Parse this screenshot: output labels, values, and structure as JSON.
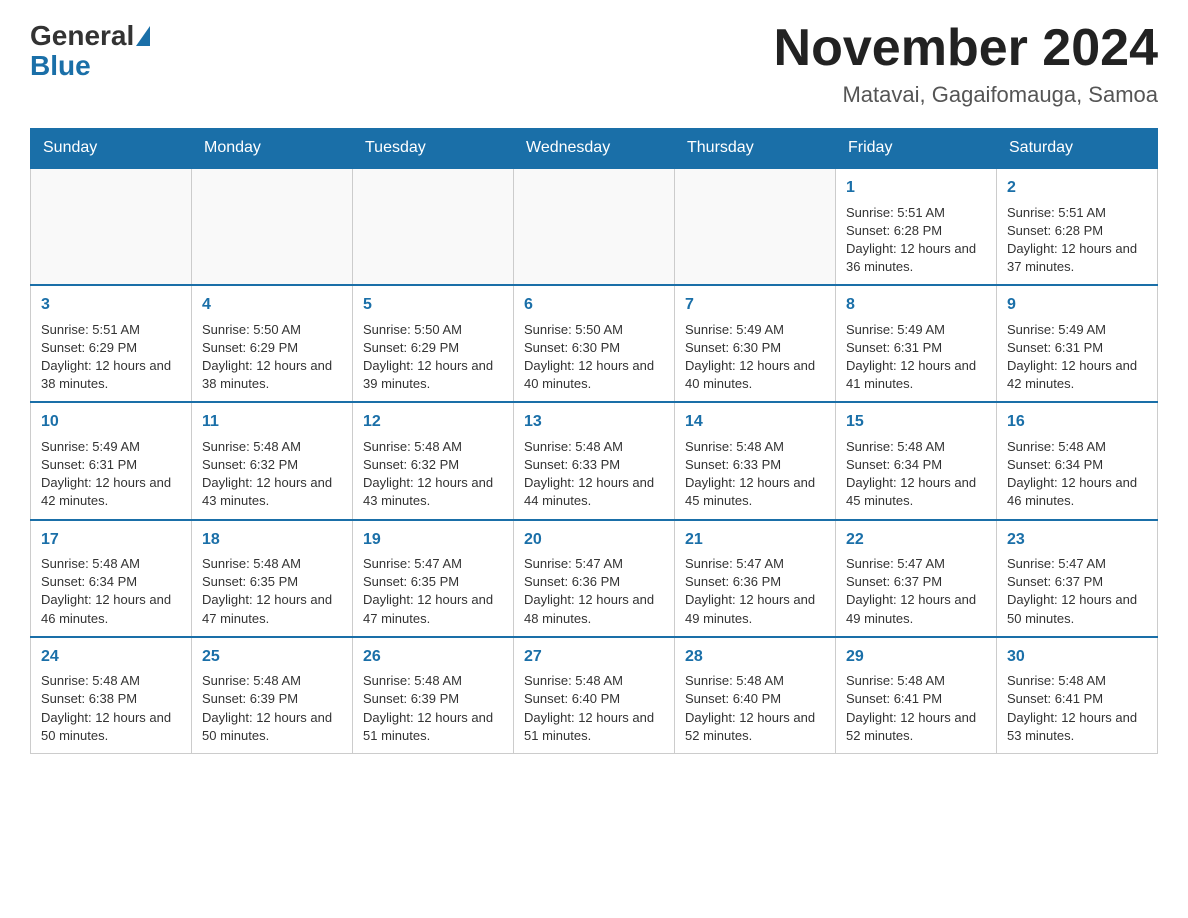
{
  "header": {
    "logo": {
      "general": "General",
      "blue": "Blue"
    },
    "title": "November 2024",
    "subtitle": "Matavai, Gagaifomauga, Samoa"
  },
  "calendar": {
    "days_of_week": [
      "Sunday",
      "Monday",
      "Tuesday",
      "Wednesday",
      "Thursday",
      "Friday",
      "Saturday"
    ],
    "weeks": [
      [
        {
          "day": "",
          "sunrise": "",
          "sunset": "",
          "daylight": ""
        },
        {
          "day": "",
          "sunrise": "",
          "sunset": "",
          "daylight": ""
        },
        {
          "day": "",
          "sunrise": "",
          "sunset": "",
          "daylight": ""
        },
        {
          "day": "",
          "sunrise": "",
          "sunset": "",
          "daylight": ""
        },
        {
          "day": "",
          "sunrise": "",
          "sunset": "",
          "daylight": ""
        },
        {
          "day": "1",
          "sunrise": "Sunrise: 5:51 AM",
          "sunset": "Sunset: 6:28 PM",
          "daylight": "Daylight: 12 hours and 36 minutes."
        },
        {
          "day": "2",
          "sunrise": "Sunrise: 5:51 AM",
          "sunset": "Sunset: 6:28 PM",
          "daylight": "Daylight: 12 hours and 37 minutes."
        }
      ],
      [
        {
          "day": "3",
          "sunrise": "Sunrise: 5:51 AM",
          "sunset": "Sunset: 6:29 PM",
          "daylight": "Daylight: 12 hours and 38 minutes."
        },
        {
          "day": "4",
          "sunrise": "Sunrise: 5:50 AM",
          "sunset": "Sunset: 6:29 PM",
          "daylight": "Daylight: 12 hours and 38 minutes."
        },
        {
          "day": "5",
          "sunrise": "Sunrise: 5:50 AM",
          "sunset": "Sunset: 6:29 PM",
          "daylight": "Daylight: 12 hours and 39 minutes."
        },
        {
          "day": "6",
          "sunrise": "Sunrise: 5:50 AM",
          "sunset": "Sunset: 6:30 PM",
          "daylight": "Daylight: 12 hours and 40 minutes."
        },
        {
          "day": "7",
          "sunrise": "Sunrise: 5:49 AM",
          "sunset": "Sunset: 6:30 PM",
          "daylight": "Daylight: 12 hours and 40 minutes."
        },
        {
          "day": "8",
          "sunrise": "Sunrise: 5:49 AM",
          "sunset": "Sunset: 6:31 PM",
          "daylight": "Daylight: 12 hours and 41 minutes."
        },
        {
          "day": "9",
          "sunrise": "Sunrise: 5:49 AM",
          "sunset": "Sunset: 6:31 PM",
          "daylight": "Daylight: 12 hours and 42 minutes."
        }
      ],
      [
        {
          "day": "10",
          "sunrise": "Sunrise: 5:49 AM",
          "sunset": "Sunset: 6:31 PM",
          "daylight": "Daylight: 12 hours and 42 minutes."
        },
        {
          "day": "11",
          "sunrise": "Sunrise: 5:48 AM",
          "sunset": "Sunset: 6:32 PM",
          "daylight": "Daylight: 12 hours and 43 minutes."
        },
        {
          "day": "12",
          "sunrise": "Sunrise: 5:48 AM",
          "sunset": "Sunset: 6:32 PM",
          "daylight": "Daylight: 12 hours and 43 minutes."
        },
        {
          "day": "13",
          "sunrise": "Sunrise: 5:48 AM",
          "sunset": "Sunset: 6:33 PM",
          "daylight": "Daylight: 12 hours and 44 minutes."
        },
        {
          "day": "14",
          "sunrise": "Sunrise: 5:48 AM",
          "sunset": "Sunset: 6:33 PM",
          "daylight": "Daylight: 12 hours and 45 minutes."
        },
        {
          "day": "15",
          "sunrise": "Sunrise: 5:48 AM",
          "sunset": "Sunset: 6:34 PM",
          "daylight": "Daylight: 12 hours and 45 minutes."
        },
        {
          "day": "16",
          "sunrise": "Sunrise: 5:48 AM",
          "sunset": "Sunset: 6:34 PM",
          "daylight": "Daylight: 12 hours and 46 minutes."
        }
      ],
      [
        {
          "day": "17",
          "sunrise": "Sunrise: 5:48 AM",
          "sunset": "Sunset: 6:34 PM",
          "daylight": "Daylight: 12 hours and 46 minutes."
        },
        {
          "day": "18",
          "sunrise": "Sunrise: 5:48 AM",
          "sunset": "Sunset: 6:35 PM",
          "daylight": "Daylight: 12 hours and 47 minutes."
        },
        {
          "day": "19",
          "sunrise": "Sunrise: 5:47 AM",
          "sunset": "Sunset: 6:35 PM",
          "daylight": "Daylight: 12 hours and 47 minutes."
        },
        {
          "day": "20",
          "sunrise": "Sunrise: 5:47 AM",
          "sunset": "Sunset: 6:36 PM",
          "daylight": "Daylight: 12 hours and 48 minutes."
        },
        {
          "day": "21",
          "sunrise": "Sunrise: 5:47 AM",
          "sunset": "Sunset: 6:36 PM",
          "daylight": "Daylight: 12 hours and 49 minutes."
        },
        {
          "day": "22",
          "sunrise": "Sunrise: 5:47 AM",
          "sunset": "Sunset: 6:37 PM",
          "daylight": "Daylight: 12 hours and 49 minutes."
        },
        {
          "day": "23",
          "sunrise": "Sunrise: 5:47 AM",
          "sunset": "Sunset: 6:37 PM",
          "daylight": "Daylight: 12 hours and 50 minutes."
        }
      ],
      [
        {
          "day": "24",
          "sunrise": "Sunrise: 5:48 AM",
          "sunset": "Sunset: 6:38 PM",
          "daylight": "Daylight: 12 hours and 50 minutes."
        },
        {
          "day": "25",
          "sunrise": "Sunrise: 5:48 AM",
          "sunset": "Sunset: 6:39 PM",
          "daylight": "Daylight: 12 hours and 50 minutes."
        },
        {
          "day": "26",
          "sunrise": "Sunrise: 5:48 AM",
          "sunset": "Sunset: 6:39 PM",
          "daylight": "Daylight: 12 hours and 51 minutes."
        },
        {
          "day": "27",
          "sunrise": "Sunrise: 5:48 AM",
          "sunset": "Sunset: 6:40 PM",
          "daylight": "Daylight: 12 hours and 51 minutes."
        },
        {
          "day": "28",
          "sunrise": "Sunrise: 5:48 AM",
          "sunset": "Sunset: 6:40 PM",
          "daylight": "Daylight: 12 hours and 52 minutes."
        },
        {
          "day": "29",
          "sunrise": "Sunrise: 5:48 AM",
          "sunset": "Sunset: 6:41 PM",
          "daylight": "Daylight: 12 hours and 52 minutes."
        },
        {
          "day": "30",
          "sunrise": "Sunrise: 5:48 AM",
          "sunset": "Sunset: 6:41 PM",
          "daylight": "Daylight: 12 hours and 53 minutes."
        }
      ]
    ]
  }
}
